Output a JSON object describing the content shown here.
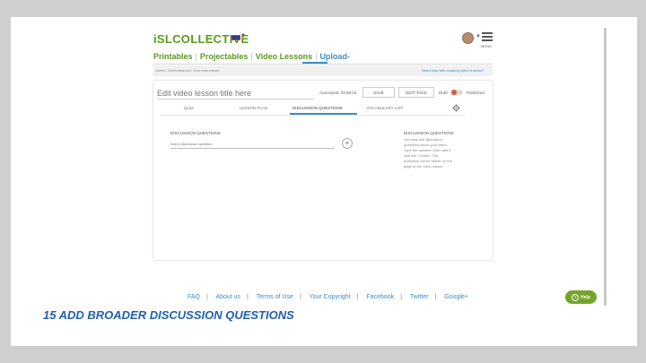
{
  "header": {
    "logo": "iSLCOLLECTIVE",
    "menu_label": "MENU"
  },
  "nav": {
    "items": [
      "Printables",
      "Projectables",
      "Video Lessons",
      "Upload"
    ],
    "upload_suffix": "-"
  },
  "breadcrumb": "Home / Video lessons / Your new lesson",
  "help_link": "Need help with creating video lessons?",
  "editor": {
    "title_placeholder": "Edit video lesson title here",
    "autosaved": "Autosaved: 09:59:03",
    "save_label": "SAVE",
    "edit_tags_label": "EDIT TAGS",
    "draft_label": "Draft",
    "published_label": "Published"
  },
  "tabs": [
    "QUIZ",
    "LESSON PLAN",
    "DISCUSSION QUESTIONS",
    "VOCABULARY LIST"
  ],
  "active_tab": "DISCUSSION QUESTIONS",
  "discussion": {
    "heading": "DISCUSSION QUESTIONS",
    "input_placeholder": "Add a discussion question",
    "add_label": "+"
  },
  "sidebar_help": {
    "heading": "DISCUSSION QUESTIONS",
    "text": "You may add discussion questions about your video. Type the question, then add it with the + button. The questions will be visible on the page of the video lesson."
  },
  "footer": {
    "links": [
      "FAQ",
      "About us",
      "Terms of Use",
      "Your Copyright",
      "Facebook",
      "Twitter",
      "Google+"
    ]
  },
  "help_button": "Help",
  "caption": "15 ADD BROADER DISCUSSION QUESTIONS",
  "colors": {
    "brand_green": "#5a9a1c",
    "accent_blue": "#3c8dc8",
    "caption_blue": "#1f5fb3",
    "help_green": "#74a52a"
  }
}
